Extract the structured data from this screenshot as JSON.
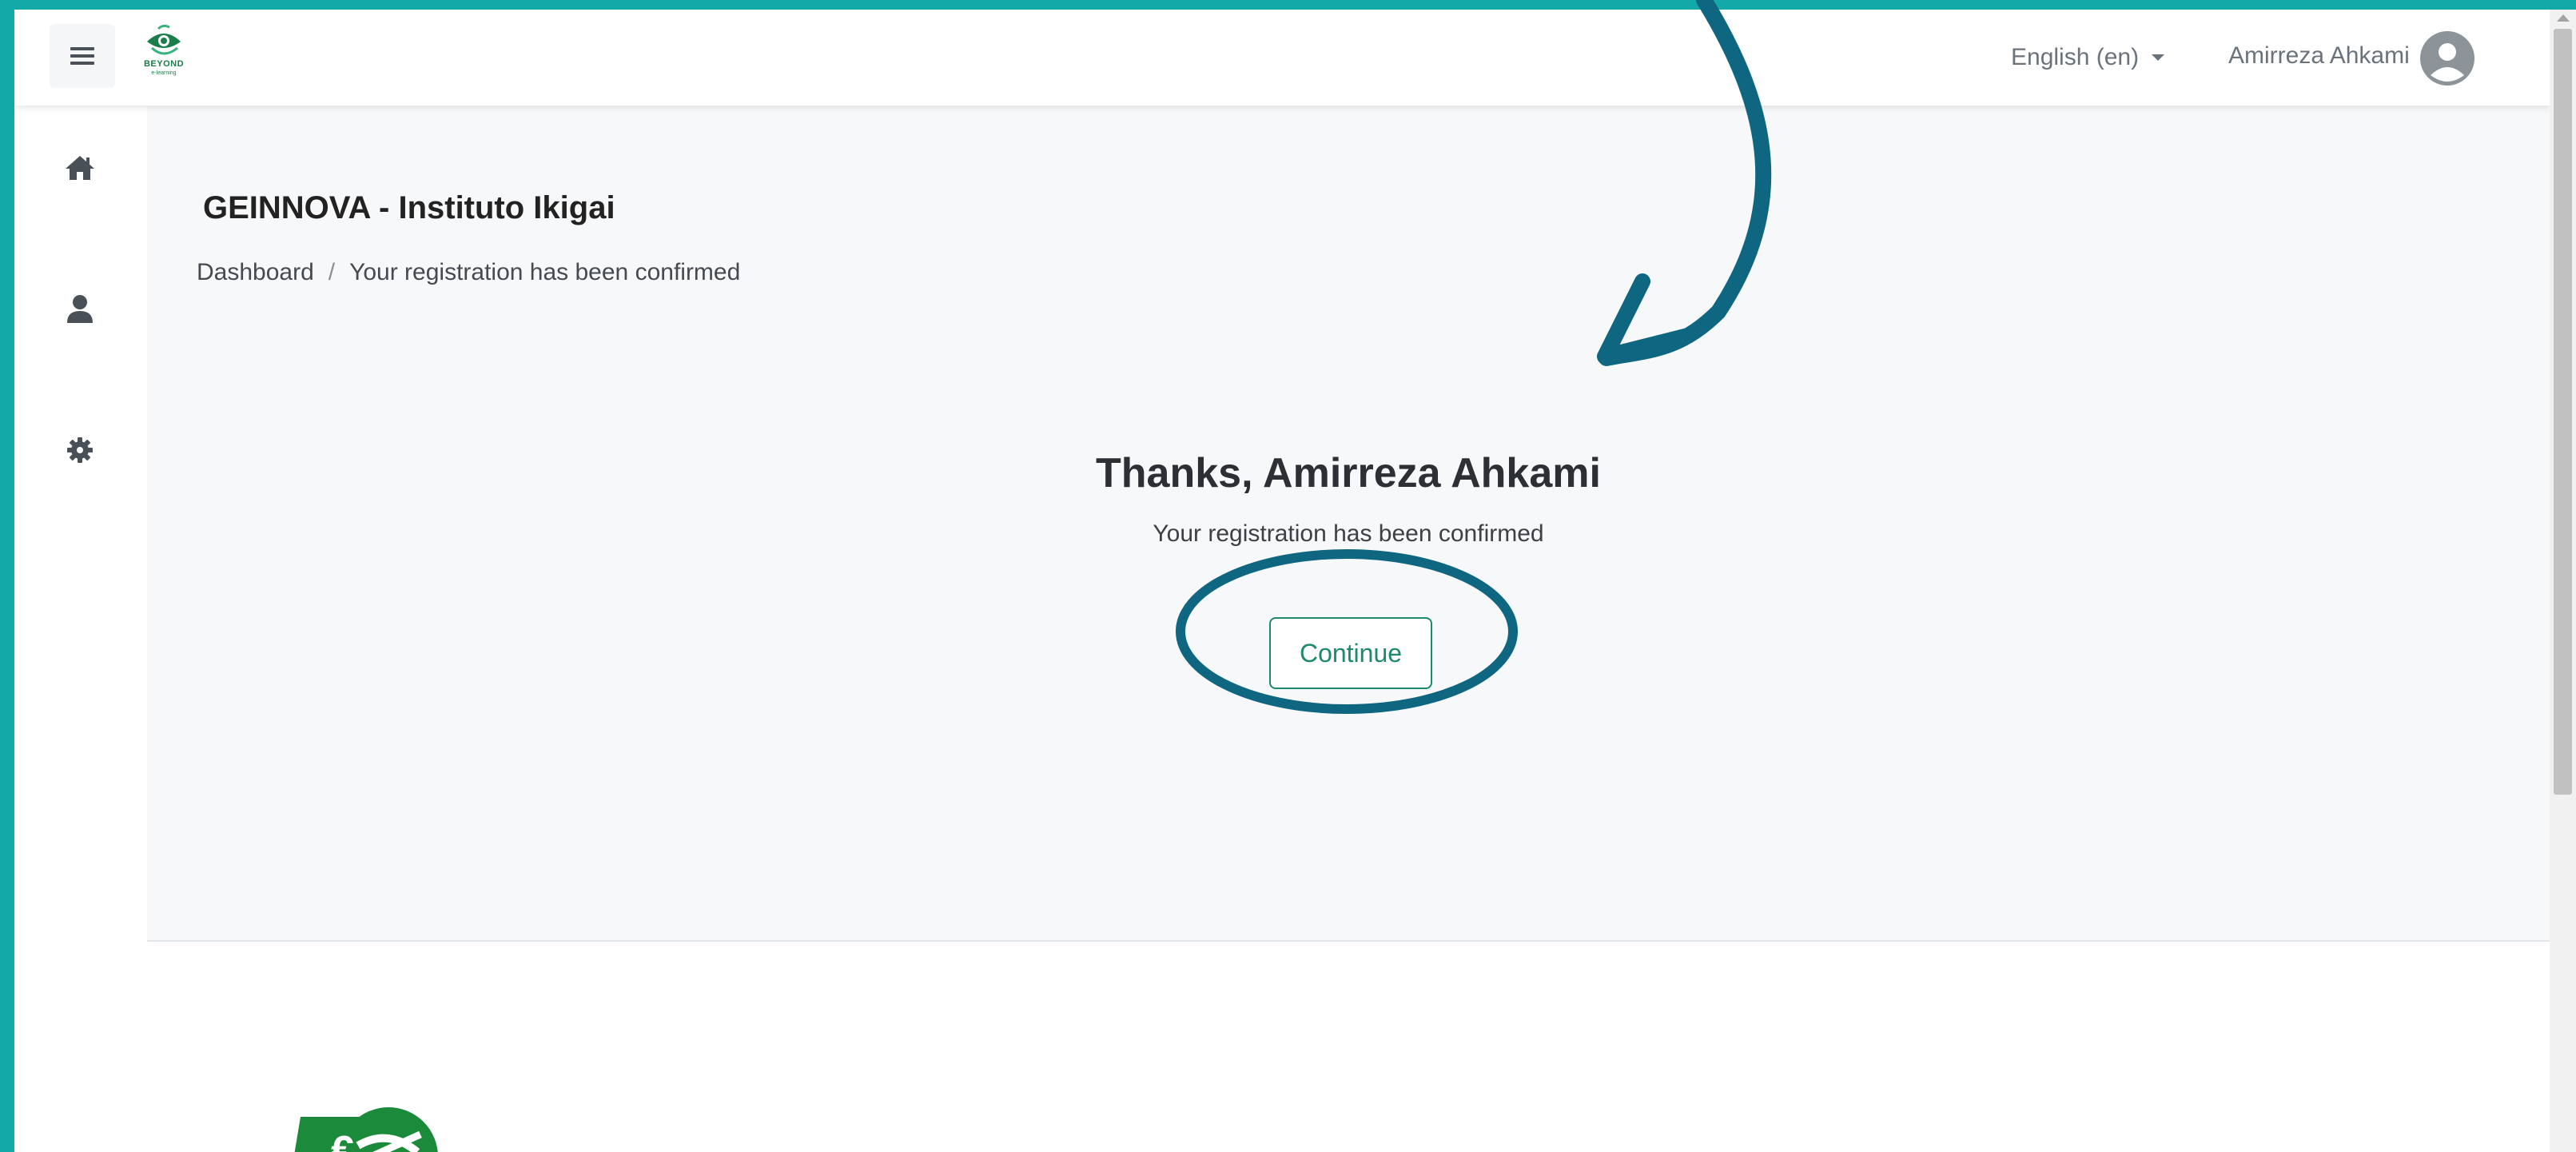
{
  "navbar": {
    "menu_icon": "hamburger-icon",
    "brand": {
      "text": "BEYOND",
      "sub": "e-learning",
      "icon": "eye-leaf-logo"
    },
    "language": {
      "label": "English (en)",
      "icon": "caret-down-icon"
    },
    "user": {
      "name": "Amirreza Ahkami",
      "icon": "user-avatar-icon"
    }
  },
  "sidebar": {
    "items": [
      {
        "icon": "home-icon"
      },
      {
        "icon": "user-icon"
      },
      {
        "icon": "gear-icon"
      }
    ]
  },
  "page": {
    "title": "GEINNOVA - Instituto Ikigai",
    "breadcrumb": {
      "home": "Dashboard",
      "separator": "/",
      "current": "Your registration has been confirmed"
    },
    "confirmation": {
      "heading": "Thanks, Amirreza Ahkami",
      "message": "Your registration has been confirmed",
      "button": "Continue"
    }
  },
  "footer": {
    "logo_icon": "euro-badge-logo",
    "logo_text": "€"
  },
  "colors": {
    "frame": "#13a9a8",
    "annotation": "#0f6680",
    "primary": "#1d8a6b",
    "brand_green": "#1b7d4a"
  }
}
